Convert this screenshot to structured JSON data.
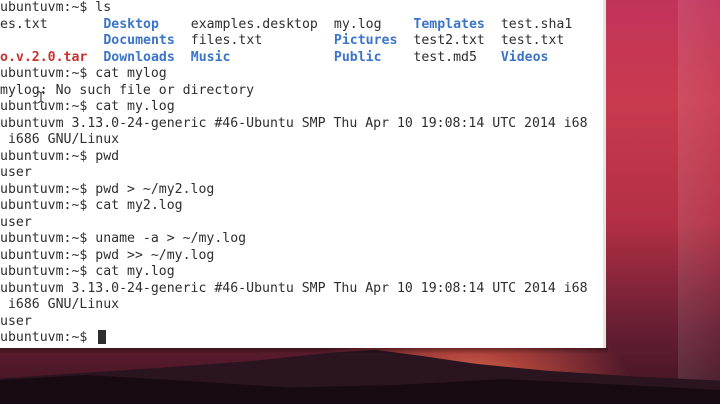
{
  "terminal": {
    "lines": [
      {
        "type": "text",
        "text": "ubuntuvm:~$ ls"
      },
      {
        "type": "columns",
        "cells": [
          {
            "text": "es.txt",
            "col": 0,
            "kind": "file"
          },
          {
            "text": "Desktop",
            "col": 13,
            "kind": "dir"
          },
          {
            "text": "examples.desktop",
            "col": 24,
            "kind": "file"
          },
          {
            "text": "my.log",
            "col": 42,
            "kind": "file"
          },
          {
            "text": "Templates",
            "col": 52,
            "kind": "dir"
          },
          {
            "text": "test.sha1",
            "col": 63,
            "kind": "file"
          }
        ]
      },
      {
        "type": "columns",
        "cells": [
          {
            "text": "Documents",
            "col": 13,
            "kind": "dir"
          },
          {
            "text": "files.txt",
            "col": 24,
            "kind": "file"
          },
          {
            "text": "Pictures",
            "col": 42,
            "kind": "dir"
          },
          {
            "text": "test2.txt",
            "col": 52,
            "kind": "file"
          },
          {
            "text": "test.txt",
            "col": 63,
            "kind": "file"
          }
        ]
      },
      {
        "type": "columns",
        "cells": [
          {
            "text": "o.v.2.0.tar",
            "col": 0,
            "kind": "archive"
          },
          {
            "text": "Downloads",
            "col": 13,
            "kind": "dir"
          },
          {
            "text": "Music",
            "col": 24,
            "kind": "dir"
          },
          {
            "text": "Public",
            "col": 42,
            "kind": "dir"
          },
          {
            "text": "test.md5",
            "col": 52,
            "kind": "file"
          },
          {
            "text": "Videos",
            "col": 63,
            "kind": "dir"
          }
        ]
      },
      {
        "type": "text",
        "text": "ubuntuvm:~$ cat mylog"
      },
      {
        "type": "text",
        "text": "mylog: No such file or directory"
      },
      {
        "type": "text",
        "text": "ubuntuvm:~$ cat my.log"
      },
      {
        "type": "text",
        "text": "ubuntuvm 3.13.0-24-generic #46-Ubuntu SMP Thu Apr 10 19:08:14 UTC 2014 i68"
      },
      {
        "type": "text",
        "text": " i686 GNU/Linux"
      },
      {
        "type": "text",
        "text": "ubuntuvm:~$ pwd"
      },
      {
        "type": "text",
        "text": "user"
      },
      {
        "type": "text",
        "text": "ubuntuvm:~$ pwd > ~/my2.log"
      },
      {
        "type": "text",
        "text": "ubuntuvm:~$ cat my2.log"
      },
      {
        "type": "text",
        "text": "user"
      },
      {
        "type": "text",
        "text": "ubuntuvm:~$ uname -a > ~/my.log"
      },
      {
        "type": "text",
        "text": "ubuntuvm:~$ pwd >> ~/my.log"
      },
      {
        "type": "text",
        "text": "ubuntuvm:~$ cat my.log"
      },
      {
        "type": "text",
        "text": "ubuntuvm 3.13.0-24-generic #46-Ubuntu SMP Thu Apr 10 19:08:14 UTC 2014 i68"
      },
      {
        "type": "text",
        "text": " i686 GNU/Linux"
      },
      {
        "type": "text",
        "text": "user"
      },
      {
        "type": "prompt",
        "text": "ubuntuvm:~$ "
      }
    ]
  },
  "colors": {
    "terminal_bg": "#ffffff",
    "text": "#2e2e2e",
    "directory": "#3b74c8",
    "archive": "#c8332f"
  }
}
